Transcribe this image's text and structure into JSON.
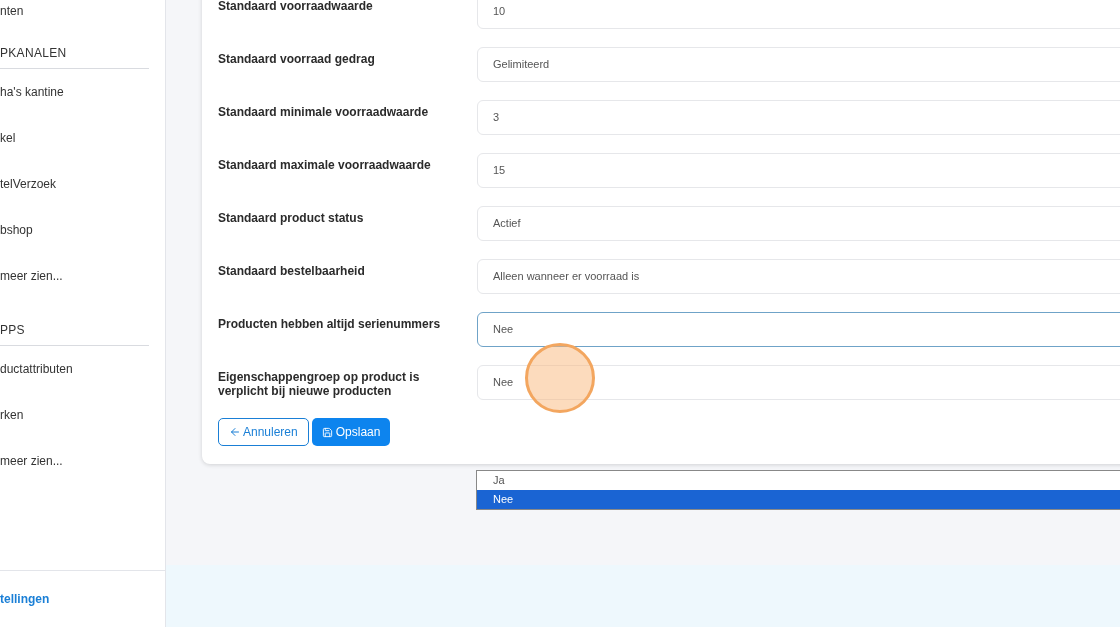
{
  "sidebar": {
    "sections": [
      {
        "items": [
          "nten"
        ]
      },
      {
        "heading": "PKANALEN",
        "items": [
          "ha's kantine",
          "kel",
          "telVerzoek",
          "bshop",
          "meer zien..."
        ]
      },
      {
        "heading": "PPS",
        "items": [
          "ductattributen",
          "rken",
          "meer zien..."
        ]
      }
    ],
    "footer_link": "tellingen"
  },
  "form": {
    "fields": [
      {
        "label": "Standaard voorraadwaarde",
        "value": "10",
        "focused": false
      },
      {
        "label": "Standaard voorraad gedrag",
        "value": "Gelimiteerd",
        "focused": false
      },
      {
        "label": "Standaard minimale voorraadwaarde",
        "value": "3",
        "focused": false
      },
      {
        "label": "Standaard maximale voorraadwaarde",
        "value": "15",
        "focused": false
      },
      {
        "label": "Standaard product status",
        "value": "Actief",
        "focused": false
      },
      {
        "label": "Standaard bestelbaarheid",
        "value": "Alleen wanneer er voorraad is",
        "focused": false
      },
      {
        "label": "Producten hebben altijd serienummers",
        "value": "Nee",
        "focused": true
      },
      {
        "label": "Eigenschappengroep op product is verplicht bij nieuwe producten",
        "value": "Nee",
        "focused": false
      }
    ],
    "cancel_button": "Annuleren",
    "save_button": "Opslaan"
  },
  "dropdown": {
    "options": [
      {
        "label": "Ja",
        "selected": false
      },
      {
        "label": "Nee",
        "selected": true
      }
    ]
  }
}
